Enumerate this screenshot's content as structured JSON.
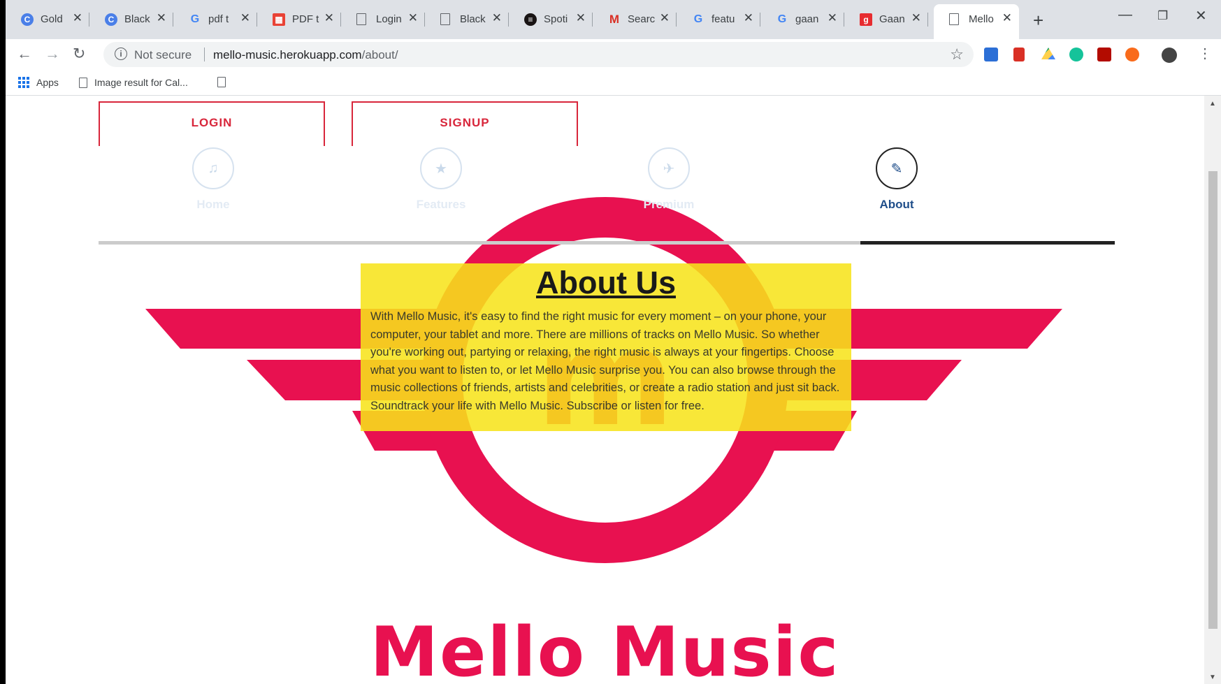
{
  "browser": {
    "tabs": [
      {
        "title": "Gold",
        "icon": "chrome-icon",
        "color": "#4a7fe8",
        "glyph": "C"
      },
      {
        "title": "Black",
        "icon": "chrome-icon",
        "color": "#4a7fe8",
        "glyph": "C"
      },
      {
        "title": "pdf t",
        "icon": "google-icon",
        "color": "#ffffff",
        "glyph": "G"
      },
      {
        "title": "PDF t",
        "icon": "pdf-tool-icon",
        "color": "#e94235",
        "glyph": "▦"
      },
      {
        "title": "Login",
        "icon": "page-icon",
        "color": "#ffffff",
        "glyph": ""
      },
      {
        "title": "Black",
        "icon": "page-icon",
        "color": "#ffffff",
        "glyph": ""
      },
      {
        "title": "Spoti",
        "icon": "spotify-icon",
        "color": "#191414",
        "glyph": "≡"
      },
      {
        "title": "Searc",
        "icon": "gmail-icon",
        "color": "#ffffff",
        "glyph": "M"
      },
      {
        "title": "featu",
        "icon": "google-icon",
        "color": "#ffffff",
        "glyph": "G"
      },
      {
        "title": "gaan",
        "icon": "google-icon",
        "color": "#ffffff",
        "glyph": "G"
      },
      {
        "title": "Gaan",
        "icon": "gaana-icon",
        "color": "#e72c30",
        "glyph": "g"
      },
      {
        "title": "Mello",
        "icon": "page-icon",
        "color": "#ffffff",
        "glyph": "",
        "active": true
      }
    ],
    "security_label": "Not secure",
    "url_host": "mello-music.herokuapp.com",
    "url_path": "/about/",
    "bookmarks": {
      "apps_label": "Apps",
      "item1_label": "Image result for Cal..."
    }
  },
  "site": {
    "login_label": "LOGIN",
    "signup_label": "SIGNUP",
    "nav": [
      {
        "label": "Home",
        "icon": "music-note-icon",
        "glyph": "♫"
      },
      {
        "label": "Features",
        "icon": "star-icon",
        "glyph": "★"
      },
      {
        "label": "Premium",
        "icon": "airplane-icon",
        "glyph": "✈"
      },
      {
        "label": "About",
        "icon": "pencil-icon",
        "glyph": "✎",
        "active": true
      }
    ],
    "about_title": "About Us",
    "about_text": "With Mello Music, it's easy to find the right music for every moment – on your phone, your computer, your tablet and more. There are millions of tracks on Mello Music. So whether you're working out, partying or relaxing, the right music is always at your fingertips. Choose what you want to listen to, or let Mello Music surprise you. You can also browse through the music collections of friends, artists and celebrities, or create a radio station and just sit back. Soundtrack your life with Mello Music. Subscribe or listen for free.",
    "brand_name": "Mello Music",
    "logo_letter": "m",
    "brand_color": "#e81150",
    "highlight_color": "#f7e31a"
  }
}
